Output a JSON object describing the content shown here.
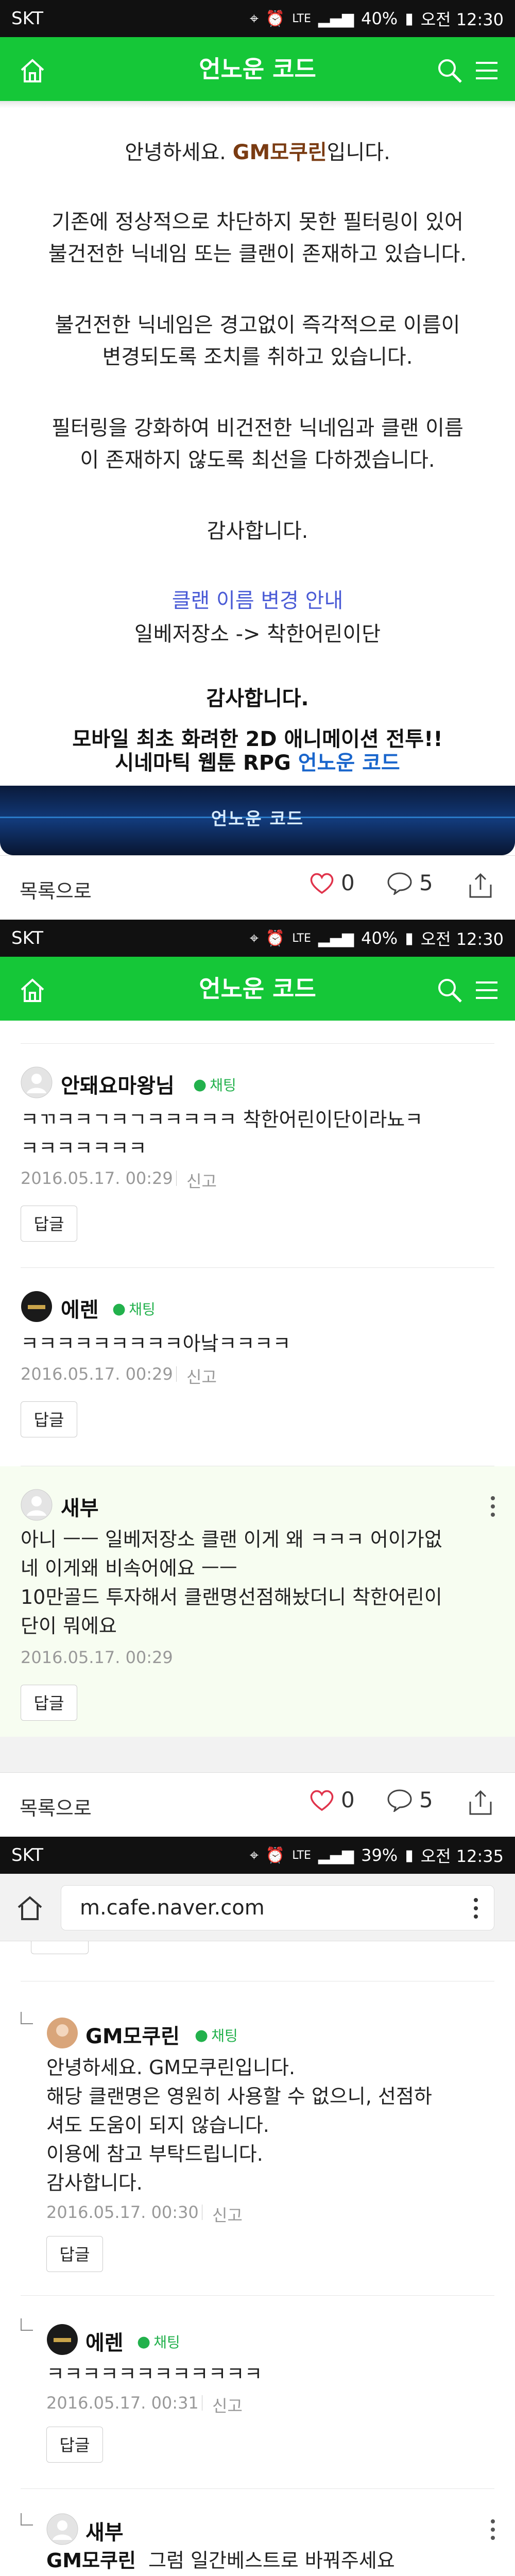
{
  "screens": [
    {
      "status": {
        "carrier": "SKT",
        "battery": "40%",
        "time": "오전 12:30",
        "network": "LTE"
      },
      "appbar": {
        "title": "언노운 코드"
      },
      "post": {
        "greeting_prefix": "안녕하세요. ",
        "greeting_brand": "GM모쿠린",
        "greeting_suffix": "입니다.",
        "para1_line1": "기존에 정상적으로 차단하지 못한 필터링이 있어",
        "para1_line2": "불건전한 닉네임 또는 클랜이 존재하고 있습니다.",
        "para2_line1": "불건전한 닉네임은 경고없이 즉각적으로 이름이",
        "para2_line2": "변경되도록 조치를 취하고 있습니다.",
        "para3_line1": "필터링을 강화하여 비건전한 닉네임과 클랜 이름",
        "para3_line2": "이 존재하지 않도록 최선을 다하겠습니다.",
        "thanks": "감사합니다.",
        "clan_notice_title": "클랜 이름 변경 안내",
        "clan_change": "일베저장소 -> 착한어린이단",
        "thanks_bold": "감사합니다.",
        "promo_line1": "모바일 최초 화려한 2D 애니메이션 전투!!",
        "promo_line2_prefix": "시네마틱 웹툰 RPG ",
        "promo_line2_link": "언노운 코드",
        "banner_logo": "언노운 코드"
      },
      "actions": {
        "back": "목록으로",
        "likes": "0",
        "comments": "5"
      }
    },
    {
      "status": {
        "carrier": "SKT",
        "battery": "40%",
        "time": "오전 12:30",
        "network": "LTE"
      },
      "appbar": {
        "title": "언노운 코드"
      },
      "comments": [
        {
          "nick": "안돼요마왕님",
          "chat": "채팅",
          "text_line1": "ㅋㄲㅋㅋㄱㅋㄱㅋㅋㅋㅋㅋ 착한어린이단이라뇨ㅋ",
          "text_line2": "ㅋㅋㅋㅋㅋㅋㅋ",
          "date": "2016.05.17. 00:29",
          "report": "신고",
          "reply": "답글"
        },
        {
          "nick": "에렌",
          "chat": "채팅",
          "text_line1": "ㅋㅋㅋㅋㅋㅋㅋㅋㅋ아낰ㅋㅋㅋㅋ",
          "date": "2016.05.17. 00:29",
          "report": "신고",
          "reply": "답글"
        },
        {
          "nick": "새부",
          "text_line1": "아니 ㅡㅡ 일베저장소 클랜 이게 왜 ㅋㅋㅋ 어이가없",
          "text_line2": "네 이게왜 비속어에요 ㅡㅡ",
          "text_line3": "10만골드 투자해서 클랜명선점해놨더니 착한어린이",
          "text_line4": "단이 뭐에요",
          "date": "2016.05.17. 00:29",
          "reply": "답글"
        }
      ],
      "actions": {
        "back": "목록으로",
        "likes": "0",
        "comments": "5"
      }
    },
    {
      "status": {
        "carrier": "SKT",
        "battery": "39%",
        "time": "오전 12:35",
        "network": "LTE"
      },
      "urlbar": {
        "url": "m.cafe.naver.com"
      },
      "replies": [
        {
          "nick": "GM모쿠린",
          "chat": "채팅",
          "text_line1": "안녕하세요. GM모쿠린입니다.",
          "text_line2": "해당 클랜명은 영원히 사용할 수 없으니, 선점하",
          "text_line3": "셔도 도움이 되지 않습니다.",
          "text_line4": "이용에 참고 부탁드립니다.",
          "text_line5": "감사합니다.",
          "date": "2016.05.17. 00:30",
          "report": "신고",
          "reply": "답글"
        },
        {
          "nick": "에렌",
          "chat": "채팅",
          "text_line1": "ㅋㅋㅋㅋㅋㅋㅋㅋㅋㅋㅋㅋ",
          "date": "2016.05.17. 00:31",
          "report": "신고",
          "reply": "답글"
        },
        {
          "nick": "새부",
          "mention": "GM모쿠린",
          "text_line1": "그럼 일간베스트로 바꿔주세요"
        }
      ]
    }
  ],
  "colors": {
    "green": "#15c738",
    "chat_green": "#22b14c",
    "brand_brown": "#7a3b12",
    "link_blue": "#4a5bd6",
    "promo_blue": "#1a66cc",
    "heart": "#e0334b"
  }
}
